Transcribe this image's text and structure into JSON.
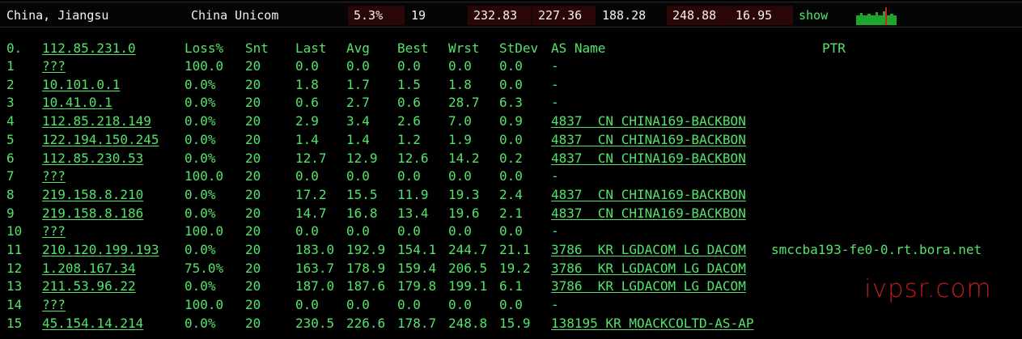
{
  "summary": {
    "location": "China, Jiangsu",
    "isp": "China Unicom",
    "loss": "5.3%",
    "count": "19",
    "v1": "232.83",
    "v2": "227.36",
    "v3": "188.28",
    "v4": "248.88",
    "v5": "16.95",
    "show": "show"
  },
  "header": {
    "idx": "0.",
    "host": "112.85.231.0",
    "loss": "Loss%",
    "snt": "Snt",
    "last": "Last",
    "avg": "Avg",
    "best": "Best",
    "wrst": "Wrst",
    "stdev": "StDev",
    "asname": "AS Name",
    "ptr": "PTR"
  },
  "rows": [
    {
      "idx": "1",
      "host": "???",
      "loss": "100.0",
      "snt": "20",
      "last": "0.0",
      "avg": "0.0",
      "best": "0.0",
      "wrst": "0.0",
      "stdev": "0.0",
      "as": "-",
      "ptr": ""
    },
    {
      "idx": "2",
      "host": "10.101.0.1",
      "loss": "0.0%",
      "snt": "20",
      "last": "1.8",
      "avg": "1.7",
      "best": "1.5",
      "wrst": "1.8",
      "stdev": "0.0",
      "as": "-",
      "ptr": ""
    },
    {
      "idx": "3",
      "host": "10.41.0.1",
      "loss": "0.0%",
      "snt": "20",
      "last": "0.6",
      "avg": "2.7",
      "best": "0.6",
      "wrst": "28.7",
      "stdev": "6.3",
      "as": "-",
      "ptr": ""
    },
    {
      "idx": "4",
      "host": "112.85.218.149",
      "loss": "0.0%",
      "snt": "20",
      "last": "2.9",
      "avg": "3.4",
      "best": "2.6",
      "wrst": "7.0",
      "stdev": "0.9",
      "as": "4837  CN CHINA169-BACKBON",
      "ptr": ""
    },
    {
      "idx": "5",
      "host": "122.194.150.245",
      "loss": "0.0%",
      "snt": "20",
      "last": "1.4",
      "avg": "1.4",
      "best": "1.2",
      "wrst": "1.9",
      "stdev": "0.0",
      "as": "4837  CN CHINA169-BACKBON",
      "ptr": ""
    },
    {
      "idx": "6",
      "host": "112.85.230.53",
      "loss": "0.0%",
      "snt": "20",
      "last": "12.7",
      "avg": "12.9",
      "best": "12.6",
      "wrst": "14.2",
      "stdev": "0.2",
      "as": "4837  CN CHINA169-BACKBON",
      "ptr": ""
    },
    {
      "idx": "7",
      "host": "???",
      "loss": "100.0",
      "snt": "20",
      "last": "0.0",
      "avg": "0.0",
      "best": "0.0",
      "wrst": "0.0",
      "stdev": "0.0",
      "as": "-",
      "ptr": ""
    },
    {
      "idx": "8",
      "host": "219.158.8.210",
      "loss": "0.0%",
      "snt": "20",
      "last": "17.2",
      "avg": "15.5",
      "best": "11.9",
      "wrst": "19.3",
      "stdev": "2.4",
      "as": "4837  CN CHINA169-BACKBON",
      "ptr": ""
    },
    {
      "idx": "9",
      "host": "219.158.8.186",
      "loss": "0.0%",
      "snt": "20",
      "last": "14.7",
      "avg": "16.8",
      "best": "13.4",
      "wrst": "19.6",
      "stdev": "2.1",
      "as": "4837  CN CHINA169-BACKBON",
      "ptr": ""
    },
    {
      "idx": "10",
      "host": "???",
      "loss": "100.0",
      "snt": "20",
      "last": "0.0",
      "avg": "0.0",
      "best": "0.0",
      "wrst": "0.0",
      "stdev": "0.0",
      "as": "-",
      "ptr": ""
    },
    {
      "idx": "11",
      "host": "210.120.199.193",
      "loss": "0.0%",
      "snt": "20",
      "last": "183.0",
      "avg": "192.9",
      "best": "154.1",
      "wrst": "244.7",
      "stdev": "21.1",
      "as": "3786  KR LGDACOM LG DACOM",
      "ptr": "smccba193-fe0-0.rt.bora.net"
    },
    {
      "idx": "12",
      "host": "1.208.167.34",
      "loss": "75.0%",
      "snt": "20",
      "last": "163.7",
      "avg": "178.9",
      "best": "159.4",
      "wrst": "206.5",
      "stdev": "19.2",
      "as": "3786  KR LGDACOM LG DACOM",
      "ptr": ""
    },
    {
      "idx": "13",
      "host": "211.53.96.22",
      "loss": "0.0%",
      "snt": "20",
      "last": "187.0",
      "avg": "187.6",
      "best": "179.8",
      "wrst": "199.1",
      "stdev": "6.1",
      "as": "3786  KR LGDACOM LG DACOM",
      "ptr": ""
    },
    {
      "idx": "14",
      "host": "???",
      "loss": "100.0",
      "snt": "20",
      "last": "0.0",
      "avg": "0.0",
      "best": "0.0",
      "wrst": "0.0",
      "stdev": "0.0",
      "as": "-",
      "ptr": ""
    },
    {
      "idx": "15",
      "host": "45.154.14.214",
      "loss": "0.0%",
      "snt": "20",
      "last": "230.5",
      "avg": "226.6",
      "best": "178.7",
      "wrst": "248.8",
      "stdev": "15.9",
      "as": "138195 KR MOACKCOLTD-AS-AP",
      "ptr": ""
    }
  ],
  "watermark": "ivpsr.com",
  "colors": {
    "terminal_green": "#54e36a",
    "summary_box": "#2a0606",
    "watermark_red": "#c11a1a",
    "sparkline_green": "#1fa52a",
    "sparkline_marker": "#d11c1c"
  }
}
